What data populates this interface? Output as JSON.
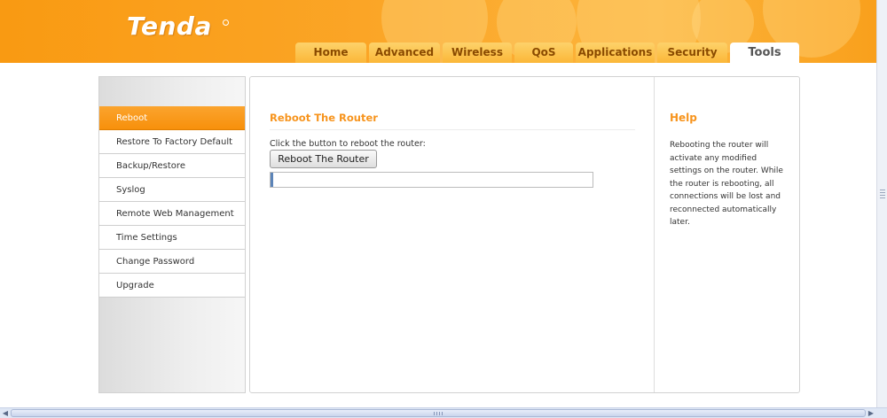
{
  "header": {
    "logo": "Tenda",
    "tabs": [
      {
        "label": "Home",
        "active": false
      },
      {
        "label": "Advanced",
        "active": false
      },
      {
        "label": "Wireless",
        "active": false
      },
      {
        "label": "QoS",
        "active": false
      },
      {
        "label": "Applications",
        "active": false
      },
      {
        "label": "Security",
        "active": false
      },
      {
        "label": "Tools",
        "active": true
      }
    ]
  },
  "sidebar": {
    "items": [
      {
        "label": "Reboot",
        "active": true
      },
      {
        "label": "Restore To Factory Default",
        "active": false
      },
      {
        "label": "Backup/Restore",
        "active": false
      },
      {
        "label": "Syslog",
        "active": false
      },
      {
        "label": "Remote Web Management",
        "active": false
      },
      {
        "label": "Time Settings",
        "active": false
      },
      {
        "label": "Change Password",
        "active": false
      },
      {
        "label": "Upgrade",
        "active": false
      }
    ]
  },
  "main": {
    "title": "Reboot The Router",
    "instruction": "Click the button to reboot the router:",
    "button_label": "Reboot The Router",
    "progress_fraction": 0.008
  },
  "help": {
    "title": "Help",
    "text": "Rebooting the router will activate any modified settings on the router. While the router is rebooting, all connections will be lost and reconnected automatically later."
  },
  "colors": {
    "accent": "#f7941d",
    "header_orange": "#f99a12",
    "progress_fill": "#5c84b8"
  }
}
